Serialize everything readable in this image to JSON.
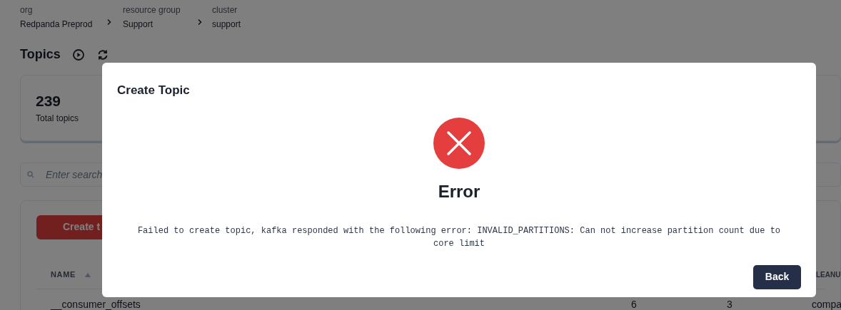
{
  "breadcrumb": [
    {
      "label": "org",
      "value": "Redpanda Preprod"
    },
    {
      "label": "resource group",
      "value": "Support"
    },
    {
      "label": "cluster",
      "value": "support"
    }
  ],
  "page": {
    "title": "Topics"
  },
  "stats": [
    {
      "value": "239",
      "label": "Total topics"
    }
  ],
  "search": {
    "placeholder": "Enter search"
  },
  "create_button": "Create t",
  "table": {
    "columns": [
      {
        "label": "NAME"
      },
      {
        "label": "LEANU"
      }
    ],
    "rows": [
      {
        "name": "__consumer_offsets",
        "column_2": "6",
        "column_3": "3",
        "column_4": "compa"
      }
    ]
  },
  "modal": {
    "title": "Create Topic",
    "heading": "Error",
    "message": "Failed to create topic, kafka responded with the following error: INVALID_PARTITIONS: Can not increase partition count due to core limit",
    "button": "Back"
  }
}
